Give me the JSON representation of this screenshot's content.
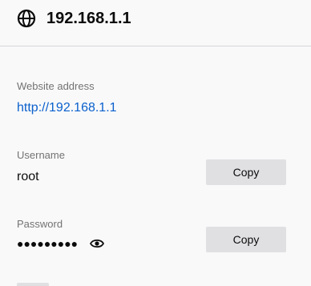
{
  "header": {
    "icon": "globe-icon",
    "title": "192.168.1.1"
  },
  "fields": {
    "website": {
      "label": "Website address",
      "value": "http://192.168.1.1"
    },
    "username": {
      "label": "Username",
      "value": "root",
      "copy_label": "Copy"
    },
    "password": {
      "label": "Password",
      "value": "●●●●●●●●●",
      "reveal_icon": "eye-icon",
      "copy_label": "Copy"
    }
  },
  "colors": {
    "link": "#0a60cc",
    "button_bg": "#e0e0e2",
    "background": "#f9f9fa"
  }
}
